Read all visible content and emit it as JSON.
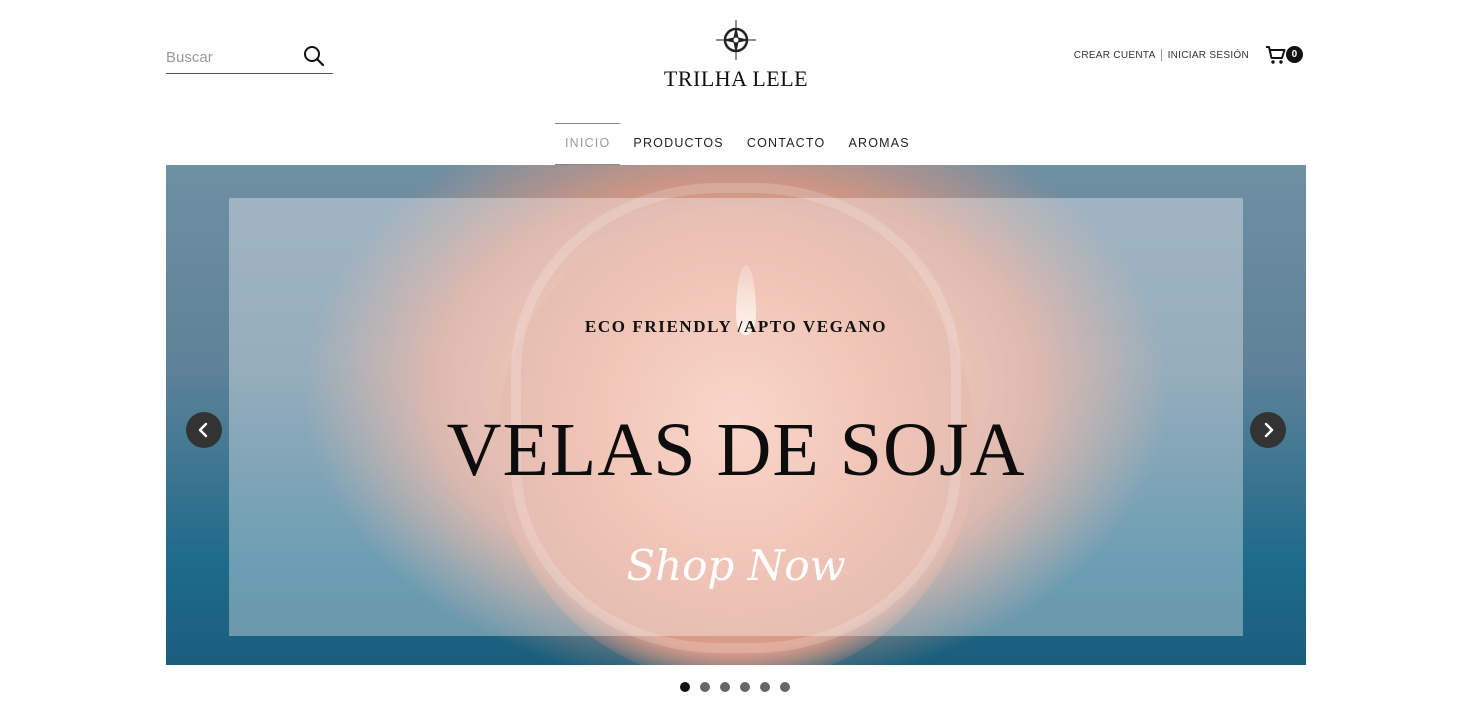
{
  "search": {
    "placeholder": "Buscar"
  },
  "brand": {
    "name": "TRILHA LELE",
    "logo_icon": "compass-icon"
  },
  "account": {
    "create_label": "CREAR CUENTA",
    "login_label": "INICIAR SESIÓN",
    "cart_count": "0",
    "cart_icon": "cart-icon"
  },
  "nav": {
    "items": [
      {
        "label": "INICIO",
        "active": true
      },
      {
        "label": "PRODUCTOS",
        "active": false
      },
      {
        "label": "CONTACTO",
        "active": false
      },
      {
        "label": "AROMAS",
        "active": false
      }
    ]
  },
  "hero": {
    "kicker": "ECO FRIENDLY /APTO VEGANO",
    "title": "VELAS DE SOJA",
    "cta": "Shop Now",
    "slide_count": 6,
    "active_slide": 1
  },
  "colors": {
    "accent": "#111111",
    "text": "#222222",
    "muted": "#999999"
  }
}
